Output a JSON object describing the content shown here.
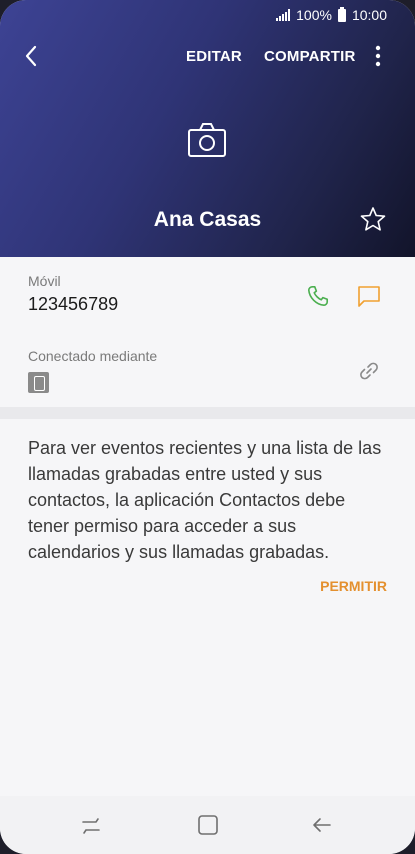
{
  "status_bar": {
    "battery": "100%",
    "time": "10:00"
  },
  "appbar": {
    "edit_label": "EDITAR",
    "share_label": "COMPARTIR"
  },
  "contact": {
    "name": "Ana Casas"
  },
  "phone": {
    "label": "Móvil",
    "number": "123456789"
  },
  "connected": {
    "label": "Conectado mediante"
  },
  "permission": {
    "text": "Para ver eventos recientes y una lista de las llamadas grabadas entre usted y sus contactos, la aplicación Contactos debe tener permiso para acceder a sus calendarios y sus llamadas grabadas.",
    "button": "PERMITIR"
  },
  "colors": {
    "header_start": "#3d4394",
    "header_end": "#12142a",
    "call_icon": "#4caf50",
    "message_icon": "#f0a030",
    "accent": "#e4902f"
  }
}
